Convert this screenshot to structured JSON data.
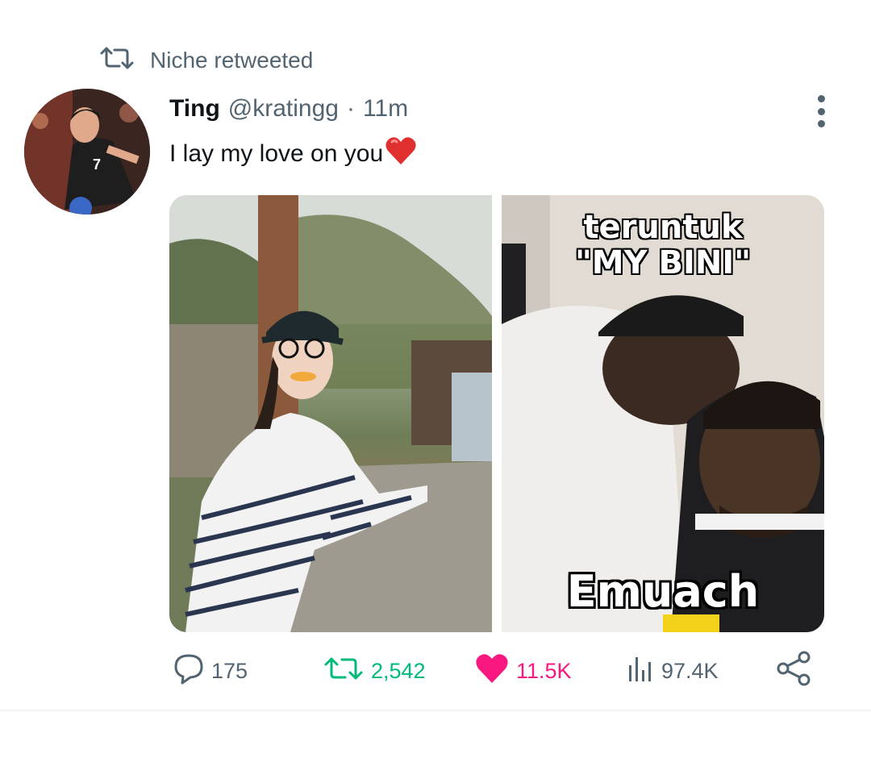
{
  "retweet": {
    "icon": "retweet-icon",
    "text": "Niche retweeted"
  },
  "tweet": {
    "name": "Ting",
    "handle": "@kratingg",
    "separator": "·",
    "time": "11m",
    "text": "I lay my love on you",
    "emoji": "heart-emoji"
  },
  "media": {
    "left_image": "photo-woman-striped-shirt",
    "right_image": "meme-barber",
    "meme_top_line1": "teruntuk",
    "meme_top_line2": "\"MY BINI\"",
    "meme_bottom": "Emuach"
  },
  "actions": {
    "replies": "175",
    "retweets": "2,542",
    "likes": "11.5K",
    "views": "97.4K"
  },
  "colors": {
    "secondary_text": "#536471",
    "retweet_green": "#00ba7c",
    "like_pink": "#f91880"
  }
}
